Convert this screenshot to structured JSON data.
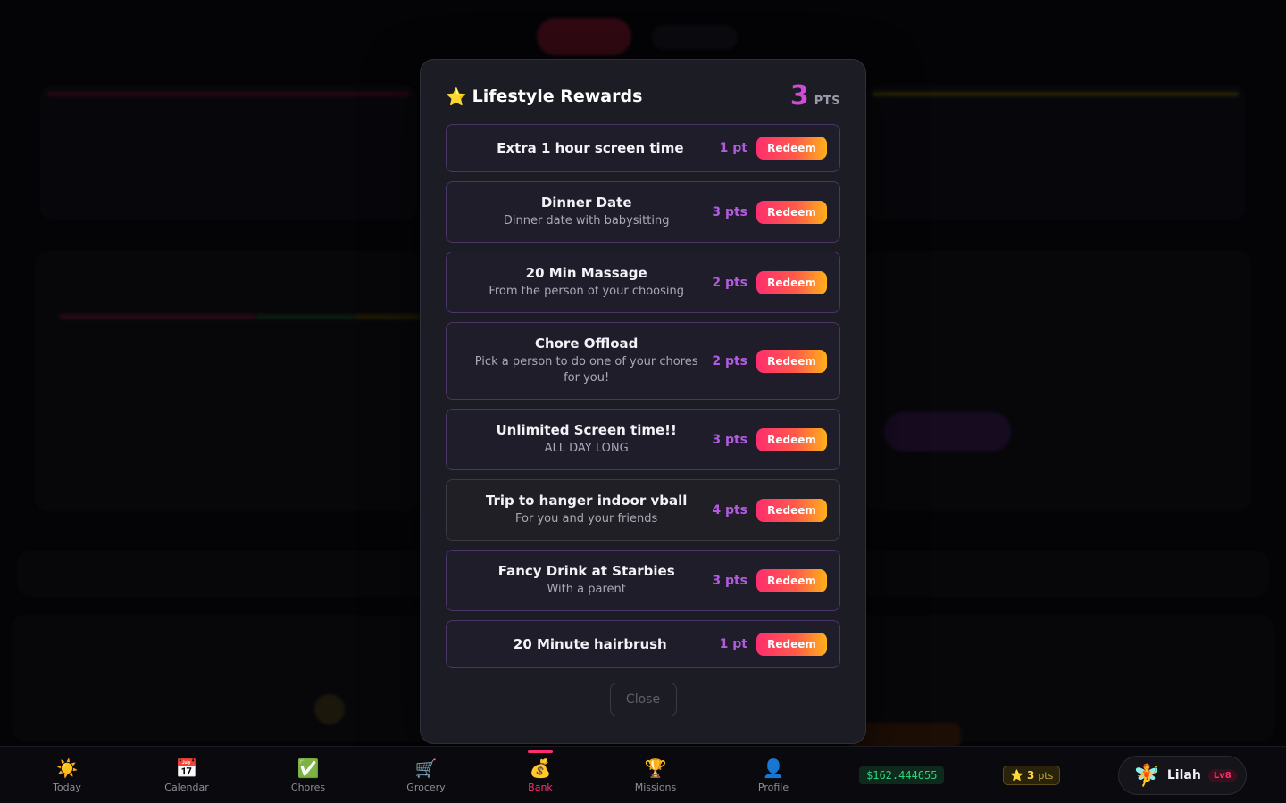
{
  "modal": {
    "title": "Lifestyle Rewards",
    "title_icon": "star-icon",
    "points_value": "3",
    "points_label": "PTS",
    "close_label": "Close",
    "rewards": [
      {
        "name": "Extra 1 hour screen time",
        "description": "",
        "cost": "1 pt",
        "button": "Redeem"
      },
      {
        "name": "Dinner Date",
        "description": "Dinner date with babysitting",
        "cost": "3 pts",
        "button": "Redeem"
      },
      {
        "name": "20 Min Massage",
        "description": "From the person of your choosing",
        "cost": "2 pts",
        "button": "Redeem"
      },
      {
        "name": "Chore Offload",
        "description": "Pick a person to do one of your chores for you!",
        "cost": "2 pts",
        "button": "Redeem"
      },
      {
        "name": "Unlimited Screen time!!",
        "description": "ALL DAY LONG",
        "cost": "3 pts",
        "button": "Redeem"
      },
      {
        "name": "Trip to hanger indoor vball",
        "description": "For you and your friends",
        "cost": "4 pts",
        "button": "Redeem"
      },
      {
        "name": "Fancy Drink at Starbies",
        "description": "With a parent",
        "cost": "3 pts",
        "button": "Redeem"
      },
      {
        "name": "20 Minute hairbrush",
        "description": "",
        "cost": "1 pt",
        "button": "Redeem"
      }
    ]
  },
  "nav": {
    "items": [
      {
        "label": "Today",
        "icon": "sun-icon",
        "glyph": "☀️"
      },
      {
        "label": "Calendar",
        "icon": "calendar-icon",
        "glyph": "📅"
      },
      {
        "label": "Chores",
        "icon": "checkmark-icon",
        "glyph": "✅"
      },
      {
        "label": "Grocery",
        "icon": "cart-icon",
        "glyph": "🛒"
      },
      {
        "label": "Bank",
        "icon": "money-bag-icon",
        "glyph": "💰"
      },
      {
        "label": "Missions",
        "icon": "trophy-icon",
        "glyph": "🏆"
      },
      {
        "label": "Profile",
        "icon": "person-icon",
        "glyph": "👤"
      }
    ],
    "active": "Bank",
    "balance": "$162.444655",
    "points_value": "3",
    "points_unit": "pts",
    "profile_name": "Lilah",
    "profile_level": "Lv8",
    "avatar_icon": "fairy-icon"
  },
  "colors": {
    "accent_pink": "#ff2d6e",
    "accent_orange": "#ffb11a",
    "points_purple": "#b25be0",
    "balance_green": "#2fd17a",
    "modal_bg": "#1c1c24"
  }
}
